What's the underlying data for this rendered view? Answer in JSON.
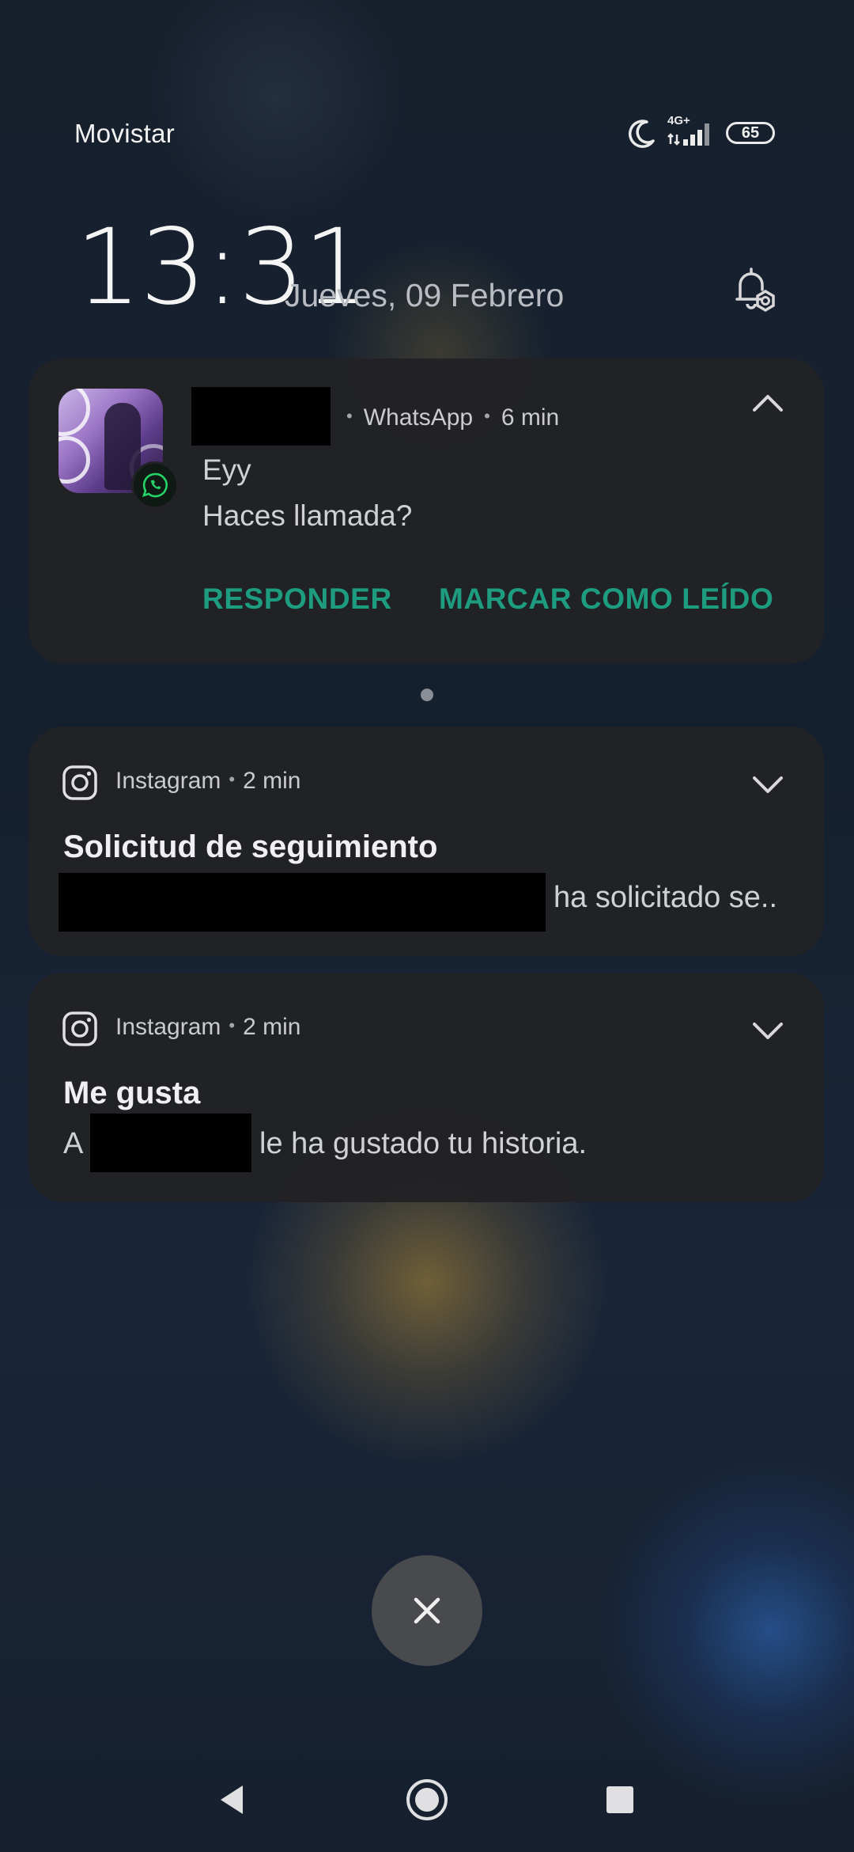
{
  "status_bar": {
    "carrier": "Movistar",
    "network": "4G+",
    "battery": "65",
    "icons": [
      "moon-icon",
      "signal-icon",
      "battery-icon"
    ]
  },
  "lock": {
    "time": "13:31",
    "date": "Jueves, 09 Febrero"
  },
  "notifications": [
    {
      "app": "WhatsApp",
      "time": "6 min",
      "lines": [
        "Eyy",
        "Haces llamada?"
      ],
      "actions": [
        "RESPONDER",
        "MARCAR COMO LEÍDO"
      ],
      "accent": "#1d9c7f"
    },
    {
      "app": "Instagram",
      "time": "2 min",
      "title": "Solicitud de seguimiento",
      "body_suffix": "ha solicitado se.."
    },
    {
      "app": "Instagram",
      "time": "2 min",
      "title": "Me gusta",
      "body_prefix": "A",
      "body_suffix": "le ha gustado tu historia."
    }
  ],
  "controls": {
    "close": "close-icon",
    "nav": [
      "back-icon",
      "home-icon",
      "recents-icon"
    ]
  }
}
